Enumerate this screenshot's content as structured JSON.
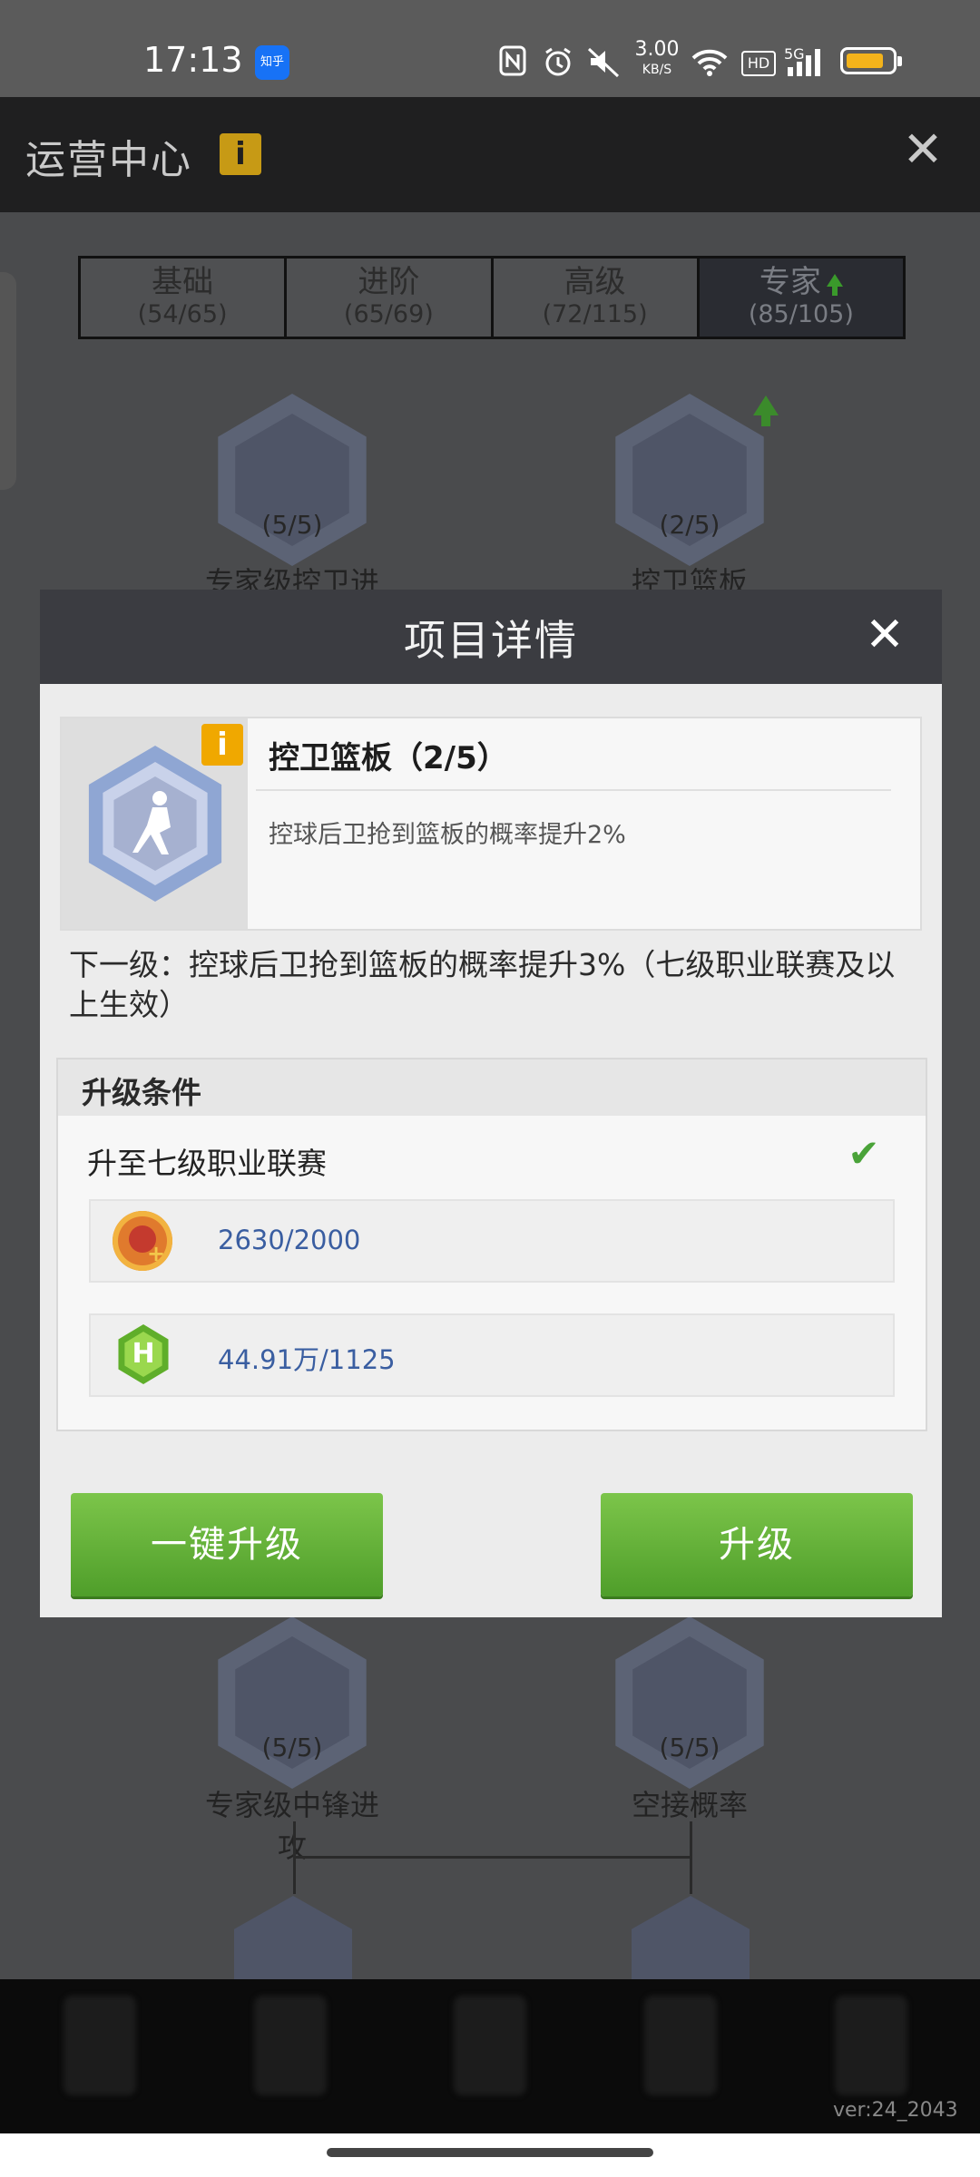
{
  "status_bar": {
    "time": "17:13",
    "zhihu_badge": "知乎",
    "net_speed_value": "3.00",
    "net_speed_unit": "KB/S",
    "hd_label": "HD",
    "network_label": "5G"
  },
  "app_bar": {
    "title": "运营中心",
    "info_glyph": "i",
    "close_glyph": "✕"
  },
  "tabs": [
    {
      "name": "基础",
      "count": "(54/65)"
    },
    {
      "name": "进阶",
      "count": "(65/69)"
    },
    {
      "name": "高级",
      "count": "(72/115)"
    },
    {
      "name": "专家",
      "count": "(85/105)"
    }
  ],
  "background_nodes": [
    {
      "level": "(5/5)",
      "name": "专家级控卫进攻"
    },
    {
      "level": "(2/5)",
      "name": "控卫篮板"
    },
    {
      "level": "(5/5)",
      "name": "专家级中锋进攻"
    },
    {
      "level": "(5/5)",
      "name": "空接概率"
    }
  ],
  "dialog": {
    "title": "项目详情",
    "close_glyph": "✕",
    "card": {
      "info_glyph": "i",
      "skill_name": "控卫篮板（2/5）",
      "description": "控球后卫抢到篮板的概率提升2%"
    },
    "next_level": "下一级：控球后卫抢到篮板的概率提升3%（七级职业联赛及以上生效）",
    "conditions": {
      "title": "升级条件",
      "requirement": "升至七级职业联赛",
      "check_glyph": "✔",
      "resources": [
        {
          "icon": "medal-coin-icon",
          "value": "2630/2000"
        },
        {
          "icon": "h-hexagon-icon",
          "icon_glyph": "H",
          "value": "44.91万/1125"
        }
      ]
    },
    "buttons": {
      "one_click": "一键升级",
      "upgrade": "升级"
    }
  },
  "footer": {
    "version": "ver:24_2043"
  },
  "colors": {
    "accent_green": "#5fae2a",
    "info_yellow": "#f0a800",
    "resource_blue": "#3a5ea1"
  }
}
